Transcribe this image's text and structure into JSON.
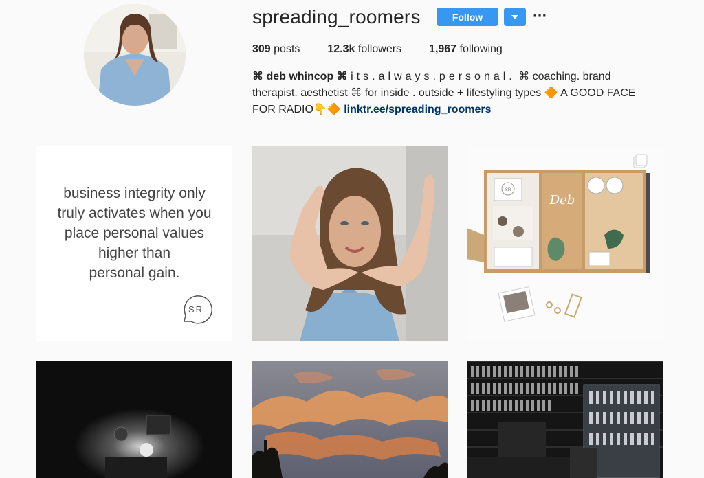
{
  "profile": {
    "username": "spreading_roomers",
    "follow_label": "Follow",
    "more_label": "···",
    "stats": {
      "posts_value": "309",
      "posts_label": "posts",
      "followers_value": "12.3k",
      "followers_label": "followers",
      "following_value": "1,967",
      "following_label": "following"
    },
    "bio": {
      "name": "⌘ deb whincop ⌘",
      "tagline": "its.always.personal.",
      "text1": "⌘ coaching. brand therapist. aesthetist ⌘ for inside . outside + lifestyling types 🔶 A GOOD FACE FOR RADIO👇🔶",
      "link": "linktr.ee/spreading_roomers"
    }
  },
  "posts": [
    {
      "quote": [
        "business integrity only",
        "truly activates when you",
        "place personal values",
        "higher than",
        "personal gain."
      ],
      "logo_text": "SR"
    },
    {},
    {
      "tray_label": "Deb",
      "stamp_text": "SR"
    },
    {},
    {},
    {}
  ],
  "colors": {
    "accent": "#3897f0",
    "link": "#003569",
    "background": "#fafafa"
  },
  "icons": {
    "more": "more-options-icon",
    "dropdown": "chevron-down-icon",
    "multi": "carousel-icon"
  }
}
